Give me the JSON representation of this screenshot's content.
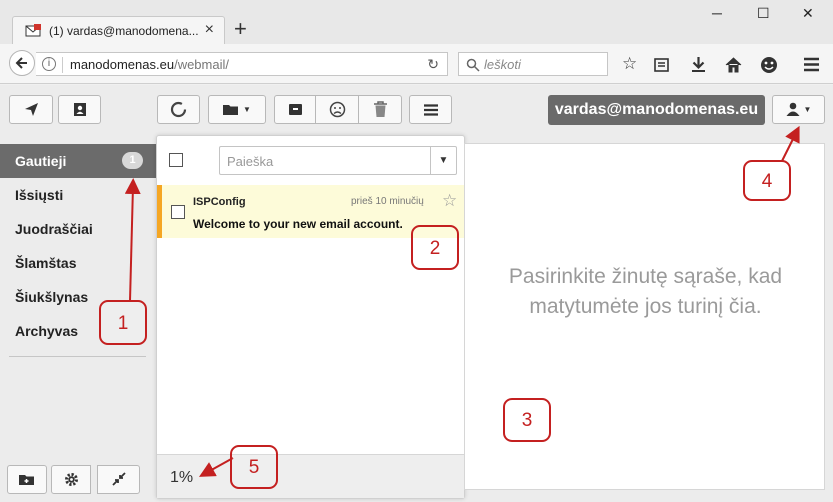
{
  "browser": {
    "tab_title": "(1) vardas@manodomena...",
    "tab_close": "×",
    "new_tab": "+",
    "url_domain": "manodomenas.eu",
    "url_path": "/webmail/",
    "search_placeholder": "leškoti",
    "info_icon": "i",
    "window_controls": [
      "─",
      "☐",
      "✕"
    ]
  },
  "toolbar": {
    "user_email": "vardas@manodomenas.eu"
  },
  "folders": [
    {
      "label": "Gautieji",
      "count": "1",
      "active": true
    },
    {
      "label": "Išsiųsti"
    },
    {
      "label": "Juodraščiai"
    },
    {
      "label": "Šlamštas"
    },
    {
      "label": "Šiukšlynas"
    },
    {
      "label": "Archyvas"
    }
  ],
  "message_list": {
    "search_placeholder": "Paieška",
    "messages": [
      {
        "sender": "ISPConfig",
        "date": "prieš 10 minučių",
        "subject": "Welcome to your new email account."
      }
    ],
    "quota": "1%"
  },
  "preview": {
    "hint": "Pasirinkite žinutę sąraše, kad matytumėte jos turinį čia."
  },
  "annotations": [
    "1",
    "2",
    "3",
    "4",
    "5"
  ],
  "colors": {
    "accent_unread": "#f5a623",
    "annotation_red": "#c42020",
    "active_folder": "#6b6b6b"
  },
  "icons": [
    "send-icon",
    "contacts-icon",
    "refresh-icon",
    "folder-icon",
    "archive-icon",
    "spam-icon",
    "trash-icon",
    "menu-icon",
    "user-icon",
    "new-folder-icon",
    "settings-icon",
    "collapse-icon",
    "star-icon"
  ]
}
